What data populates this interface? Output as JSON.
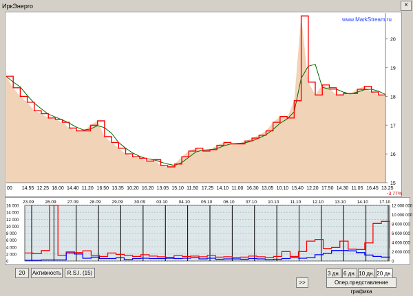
{
  "window": {
    "title": "ИркЭнерго",
    "close_label": "×",
    "watermark": "www.MarkStream.ru",
    "change_pct": "-3.77%"
  },
  "controls": {
    "period": "20",
    "activity": "Активность",
    "rsi": "R.S.I. (15)",
    "scroll": ">>",
    "ranges": [
      "3 дн.",
      "6 дн.",
      "10 дн.",
      "20 дн."
    ],
    "selected_range": "20 дн.",
    "oper_view": "Опер.представление графика"
  },
  "colors": {
    "area_fill": "#f1d4b8",
    "price_line": "#ff0000",
    "moving_average": "#006600",
    "volume_line": "#0000ff",
    "rsi_line": "#ff0000",
    "panel_bg": "#dde6e8"
  },
  "chart_data": [
    {
      "type": "area",
      "title": "",
      "x_tick_labels": [
        "00",
        "14.55",
        "12.25",
        "18.00",
        "14.40",
        "11.20",
        "16.50",
        "13.35",
        "10.20",
        "16.20",
        "13.05",
        "15.10",
        "11.50",
        "17.25",
        "14.10",
        "11.00",
        "16.30",
        "13.05",
        "10.10",
        "15.40",
        "12.20",
        "17.50",
        "14.30",
        "11.05",
        "16.45",
        "13.25"
      ],
      "y_axis_ticks": [
        15,
        16,
        17,
        18,
        19,
        20
      ],
      "ylim": [
        15,
        20.9
      ],
      "series": [
        {
          "values": [
            18.7,
            18.3,
            18.0,
            17.8,
            17.5,
            17.4,
            17.25,
            17.2,
            17.1,
            16.9,
            16.8,
            16.8,
            17.0,
            17.15,
            16.6,
            16.4,
            16.2,
            16.0,
            15.9,
            15.85,
            15.75,
            15.8,
            15.6,
            15.55,
            15.65,
            15.9,
            16.1,
            16.2,
            16.1,
            16.15,
            16.3,
            16.4,
            16.35,
            16.35,
            16.45,
            16.55,
            16.65,
            16.8,
            17.1,
            17.3,
            17.25,
            17.85,
            20.8,
            18.5,
            18.05,
            18.4,
            18.3,
            18.05,
            18.1,
            18.1,
            18.25,
            18.35,
            18.15,
            18.05,
            18.0
          ]
        }
      ]
    },
    {
      "type": "line",
      "title": "",
      "x_tick_labels": [
        "23.09",
        "26.09",
        "27.09",
        "28.09",
        "29.09",
        "30.09",
        "03.10",
        "04.10",
        "05.10",
        "06.10",
        "07.10",
        "10.10",
        "11.10",
        "12.10",
        "13.10",
        "14.10",
        "17.10"
      ],
      "y_left_ticks": [
        "0",
        "2 000",
        "4 000",
        "6 000",
        "8 000",
        "10 000",
        "12 000",
        "14 000",
        "16 000"
      ],
      "y_right_ticks": [
        "0",
        "2 000 000",
        "4 000 000",
        "6 000 000",
        "8 000 000",
        "10 000 000",
        "12 000 000"
      ],
      "series": [
        {
          "values": [
            2300,
            2100,
            3000,
            16000,
            1600,
            2600,
            2400,
            2900,
            1600,
            1300,
            2300,
            1900,
            1600,
            1300,
            1800,
            1400,
            1200,
            1000,
            1500,
            1300,
            1400,
            1200,
            1600,
            1100,
            1200,
            1000,
            1100,
            1400,
            1200,
            1000,
            1300,
            2700,
            1300,
            2700,
            5700,
            6200,
            3600,
            3900,
            5700,
            3400,
            3300,
            5200,
            10800,
            11400,
            3600
          ]
        },
        {
          "values": [
            200,
            200,
            300,
            300,
            300,
            2300,
            2000,
            800,
            1100,
            700,
            700,
            900,
            400,
            700,
            800,
            700,
            700,
            800,
            700,
            800,
            900,
            600,
            800,
            500,
            600,
            600,
            500,
            700,
            600,
            400,
            500,
            700,
            900,
            800,
            900,
            1800,
            2200,
            3000,
            3000,
            2900,
            2400,
            1700,
            1300,
            1100,
            900
          ]
        }
      ]
    }
  ]
}
